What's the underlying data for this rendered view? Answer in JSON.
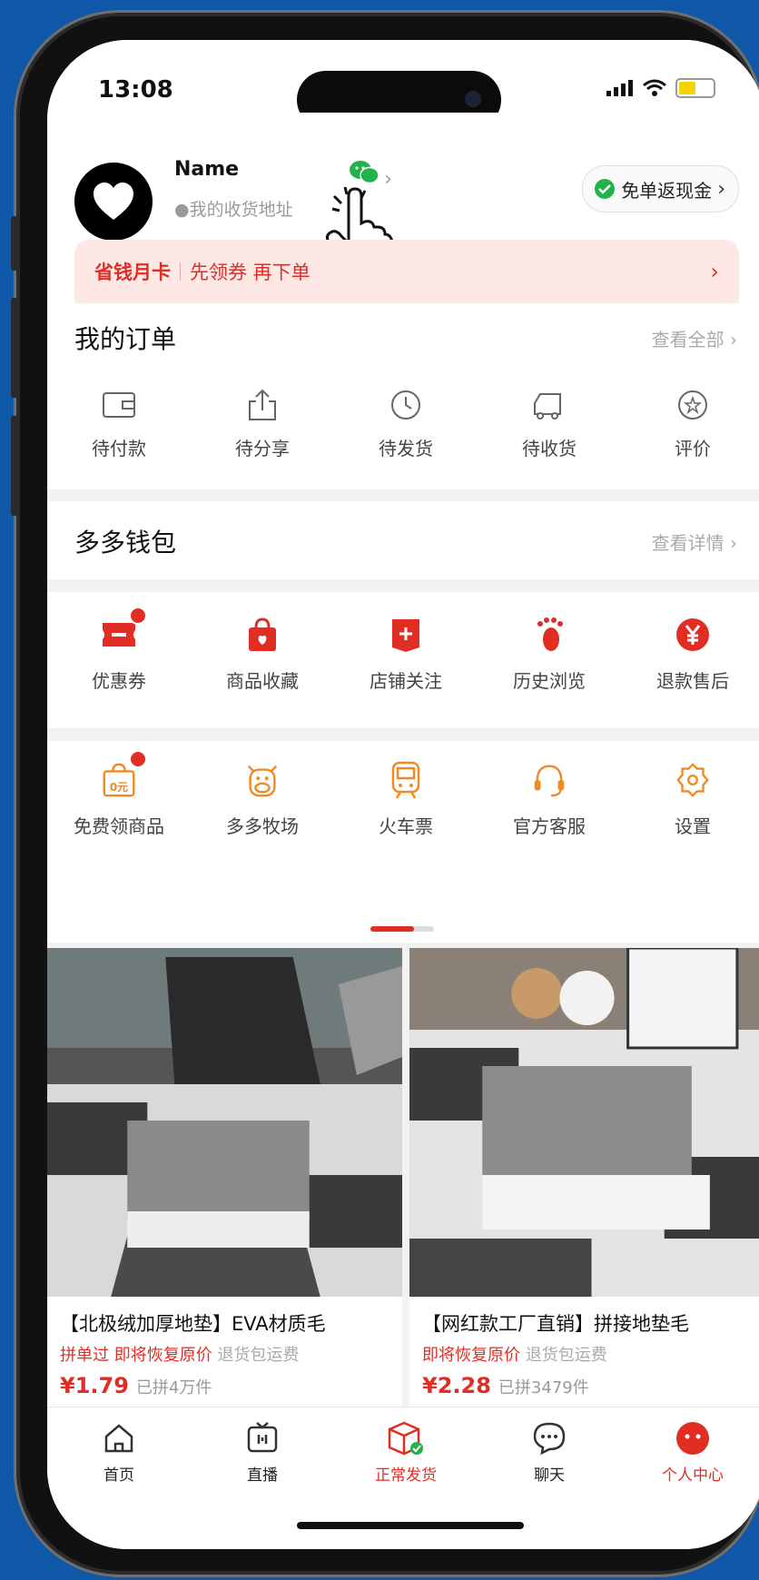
{
  "status": {
    "time": "13:08"
  },
  "header": {
    "name": "Name",
    "address": "我的收货地址",
    "cashback": "免单返现金",
    "monthly_card": "省钱月卡",
    "monthly_desc": "先领券 再下单"
  },
  "orders": {
    "title": "我的订单",
    "link": "查看全部",
    "items": [
      "待付款",
      "待分享",
      "待发货",
      "待收货",
      "评价"
    ]
  },
  "wallet": {
    "title": "多多钱包",
    "link": "查看详情"
  },
  "services": {
    "items": [
      "优惠券",
      "商品收藏",
      "店铺关注",
      "历史浏览",
      "退款售后"
    ]
  },
  "tools": {
    "items": [
      "免费领商品",
      "多多牧场",
      "火车票",
      "官方客服",
      "设置"
    ],
    "coupon_text": "0元"
  },
  "products": [
    {
      "name": "【北极绒加厚地垫】EVA材质毛",
      "tag1": "拼单过",
      "tag2": "即将恢复原价",
      "tag3": "退货包运费",
      "price": "¥1.79",
      "sold": "已拼4万件"
    },
    {
      "name": "【网红款工厂直销】拼接地垫毛",
      "tag1": "",
      "tag2": "即将恢复原价",
      "tag3": "退货包运费",
      "price": "¥2.28",
      "sold": "已拼3479件"
    }
  ],
  "tabbar": {
    "items": [
      "首页",
      "直播",
      "正常发货",
      "聊天",
      "个人中心"
    ]
  },
  "colors": {
    "brand_red": "#e02e24",
    "background": "#0f58a8"
  }
}
